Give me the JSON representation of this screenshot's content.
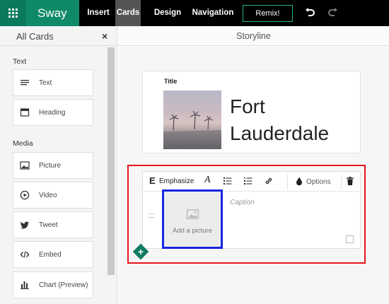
{
  "app": {
    "name": "Sway",
    "icons": {
      "apps": "app-launcher-icon",
      "undo": "undo-icon",
      "redo": "redo-icon"
    },
    "colors": {
      "brand": "#0e8a68",
      "topbar": "#000000",
      "active_tab": "#555555",
      "highlight_red": "#e8141e",
      "highlight_blue": "#1726e0"
    }
  },
  "menu": {
    "items": [
      {
        "label": "Insert",
        "active": false
      },
      {
        "label": "Cards",
        "active": true
      },
      {
        "label": "Design",
        "active": false
      },
      {
        "label": "Navigation",
        "active": false
      }
    ],
    "remix_label": "Remix!"
  },
  "left_panel": {
    "title": "All Cards",
    "close_glyph": "×",
    "sections": [
      {
        "label": "Text",
        "items": [
          {
            "label": "Text",
            "icon": "text-lines-icon"
          },
          {
            "label": "Heading",
            "icon": "heading-icon"
          }
        ]
      },
      {
        "label": "Media",
        "items": [
          {
            "label": "Picture",
            "icon": "picture-icon"
          },
          {
            "label": "Video",
            "icon": "video-play-icon"
          },
          {
            "label": "Tweet",
            "icon": "twitter-bird-icon"
          },
          {
            "label": "Embed",
            "icon": "embed-code-icon"
          },
          {
            "label": "Chart (Preview)",
            "icon": "bar-chart-icon"
          }
        ]
      }
    ]
  },
  "storyline": {
    "title": "Storyline",
    "title_card": {
      "label": "Title",
      "heading": "Fort Lauderdale",
      "heading_line1": "Fort",
      "heading_line2": "Lauderdale"
    },
    "editor_card": {
      "toolbar": {
        "style_glyph": "E",
        "emphasize_label": "Emphasize",
        "italic_glyph": "A",
        "options_label": "Options",
        "icons": [
          "bullet-list-icon",
          "numbered-list-icon",
          "link-icon",
          "droplet-icon",
          "trash-icon"
        ]
      },
      "picture_placeholder": "Add a picture",
      "caption_placeholder": "Caption"
    },
    "add_card_glyph": "+"
  }
}
